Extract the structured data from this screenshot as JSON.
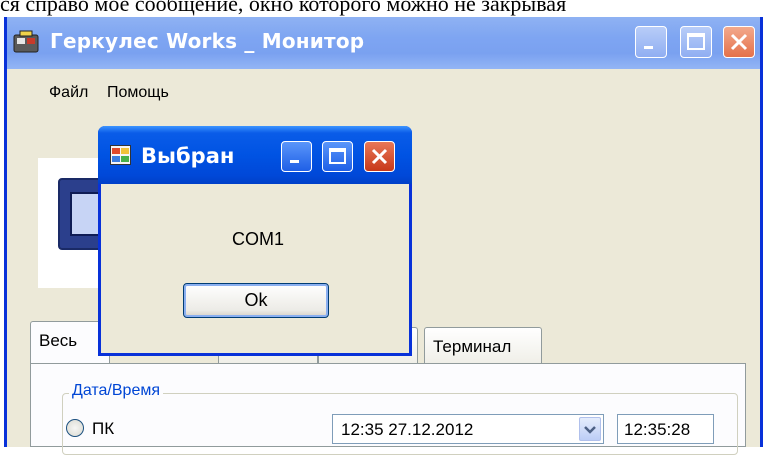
{
  "document_text": "ся справо мое сообщение, окно которого можно не закрывая",
  "main_window": {
    "title": "Геркулес Works _ Монитор",
    "menu": [
      "Файл",
      "Помощь"
    ]
  },
  "tabs": [
    {
      "label": "Весь"
    },
    {
      "label": "Терминал"
    }
  ],
  "date_time_group": {
    "legend": "Дата/Время",
    "radio_label": "ПК",
    "combo_value": "12:35 27.12.2012",
    "time_value": "12:35:28"
  },
  "dialog": {
    "title": "Выбран",
    "message": "COM1",
    "ok_label": "Ok"
  },
  "colors": {
    "xp_title_blue": "#0053e3",
    "xp_border_blue": "#0831d9",
    "inactive_title": "#7ea5f2",
    "close_red": "#e4714a",
    "face": "#ece9d8",
    "group_label": "#0046d5"
  },
  "icons": [
    "app-icon",
    "minimize-icon",
    "maximize-icon",
    "close-icon",
    "dialog-icon",
    "chevron-down-icon"
  ]
}
